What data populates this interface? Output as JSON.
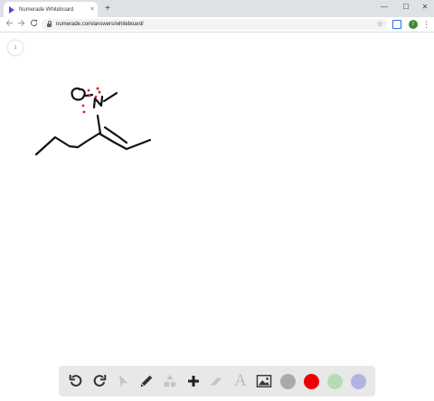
{
  "browser": {
    "tab_title": "Numerade Whiteboard",
    "tab_close": "×",
    "new_tab": "+",
    "window_controls": [
      "—",
      "☐",
      "✕"
    ],
    "url": "numerade.com/answers/whiteboard/",
    "profile_initial": "I",
    "bookmark_icon": "star-icon"
  },
  "canvas": {
    "page_number": "1",
    "ink_colors": {
      "black": "#111111",
      "red": "#e0202e"
    }
  },
  "toolbar": {
    "tools": [
      "undo",
      "redo",
      "select",
      "pen",
      "shapes",
      "add",
      "eraser",
      "text",
      "image"
    ],
    "text_tool_glyph": "A",
    "colors": [
      "#aaaaaa",
      "#ee0000",
      "#b5dcb5",
      "#b3b3e0"
    ],
    "selected_color": "#ee0000"
  }
}
